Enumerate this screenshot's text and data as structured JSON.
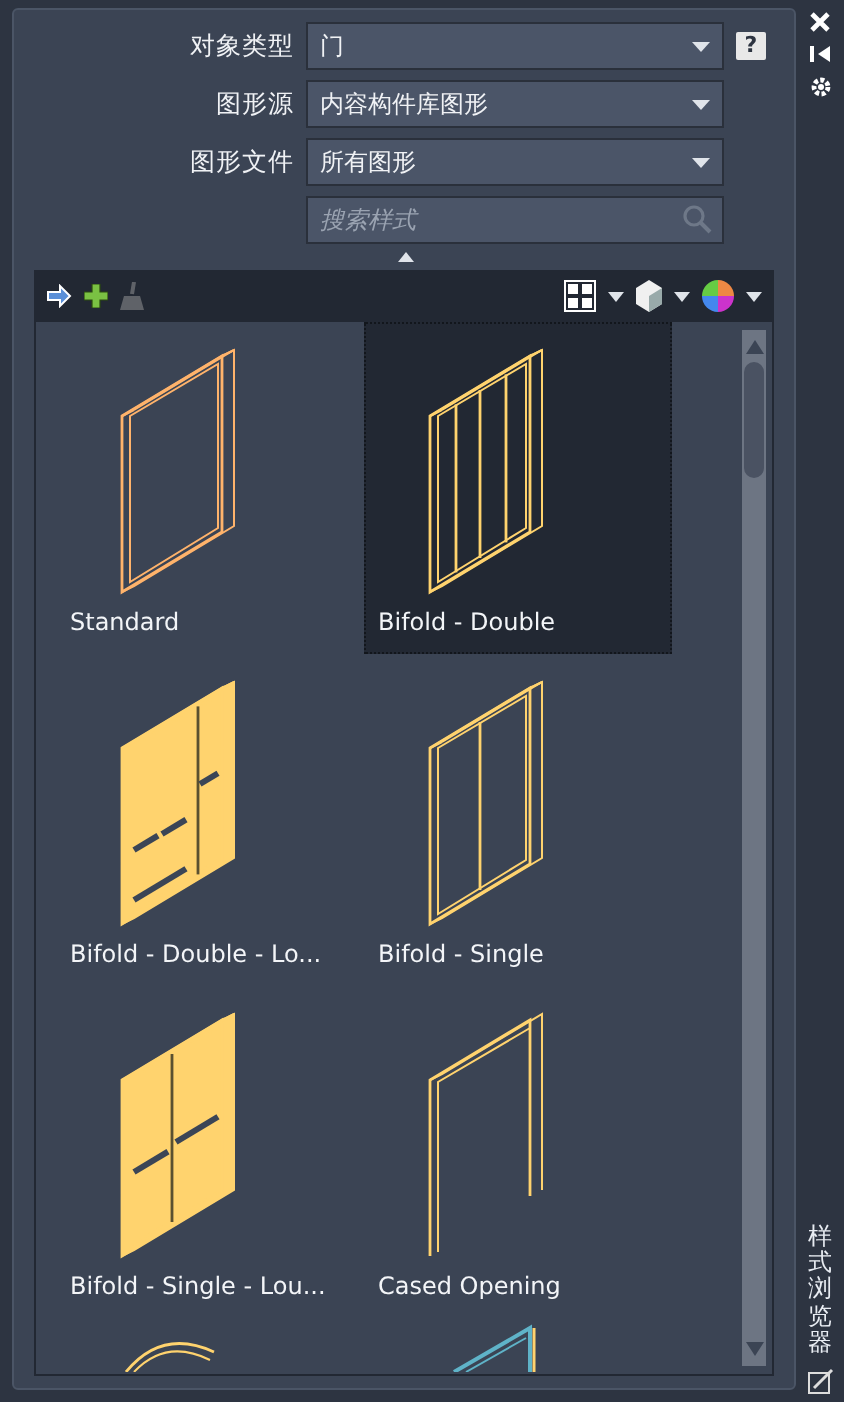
{
  "filters": [
    {
      "label": "对象类型",
      "value": "门"
    },
    {
      "label": "图形源",
      "value": "内容构件库图形"
    },
    {
      "label": "图形文件",
      "value": "所有图形"
    }
  ],
  "help": "?",
  "search": {
    "placeholder": "搜索样式"
  },
  "toolbar": {
    "clean_disabled": true
  },
  "items": [
    {
      "name": "Standard",
      "kind": "frame",
      "selected": false
    },
    {
      "name": "Bifold - Double",
      "kind": "bifold-double",
      "selected": true
    },
    {
      "name": "Bifold - Double - Lo...",
      "kind": "louver-double",
      "selected": false
    },
    {
      "name": "Bifold - Single",
      "kind": "bifold-single",
      "selected": false
    },
    {
      "name": "Bifold - Single - Lou...",
      "kind": "louver-single",
      "selected": false
    },
    {
      "name": "Cased Opening",
      "kind": "cased",
      "selected": false
    },
    {
      "kind": "arch",
      "selected": false
    },
    {
      "kind": "frame-teal",
      "selected": false
    }
  ],
  "side_title": "样式浏览器"
}
